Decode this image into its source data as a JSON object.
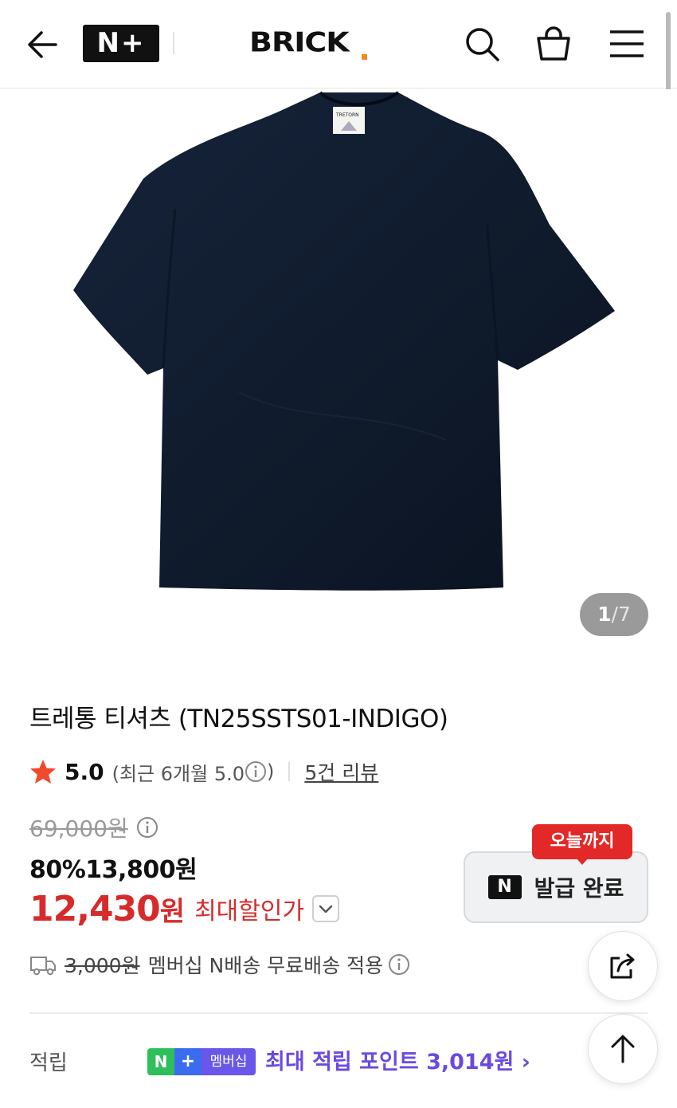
{
  "header": {
    "nplus_label": "N+",
    "logo_text": "BRICK",
    "icons": [
      "back-arrow-icon",
      "search-icon",
      "shopping-bag-icon",
      "menu-icon"
    ]
  },
  "gallery": {
    "current": "1",
    "total": "/7",
    "image_description_icon": "product-photo"
  },
  "product": {
    "title": "트레통 티셔츠 (TN25SSTS01-INDIGO)",
    "rating": "5.0",
    "recent_rating": "(최근 6개월 5.0",
    "recent_close": ")",
    "review_link": "5건 리뷰",
    "original_price": "69,000원",
    "sale_price": "80%13,800원",
    "best_price": "12,430",
    "best_price_unit": "원",
    "best_price_label": "최대할인가"
  },
  "coupon": {
    "tag": "오늘까지",
    "badge": "N",
    "label": "발급 완료"
  },
  "shipping": {
    "fee": "3,000원",
    "description": "멤버십 N배송 무료배송 적용"
  },
  "points": {
    "label": "적립",
    "badge_n": "N",
    "badge_plus": "+",
    "badge_membership": "멤버십",
    "text": "최대 적립 포인트 3,014원 ›"
  },
  "colors": {
    "accent_red": "#d72b2b",
    "membership_purple": "#6a49e2",
    "tag_red": "#e32828",
    "star": "#f04a2e",
    "shirt_navy": "#0f1a2b"
  }
}
